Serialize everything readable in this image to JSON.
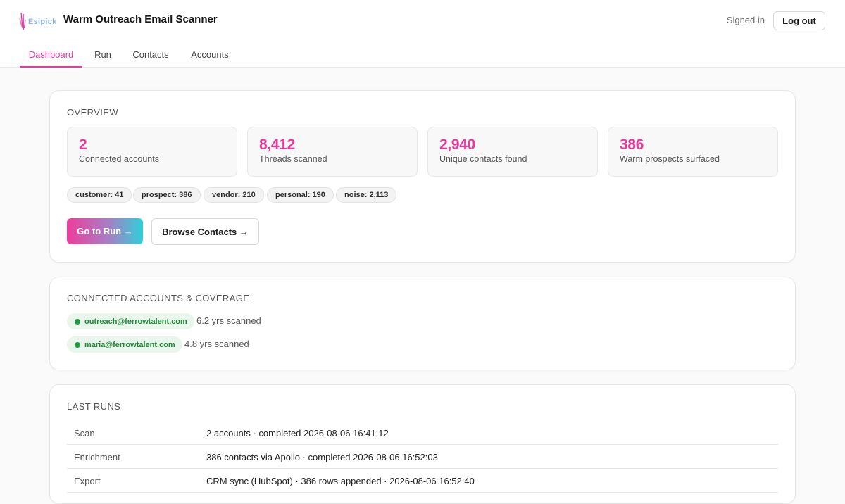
{
  "header": {
    "logo_text": "Esipick",
    "title": "Warm Outreach Email Scanner",
    "signed_in_label": "Signed in",
    "logout_label": "Log out"
  },
  "tabs": [
    {
      "label": "Dashboard",
      "active": true
    },
    {
      "label": "Run",
      "active": false
    },
    {
      "label": "Contacts",
      "active": false
    },
    {
      "label": "Accounts",
      "active": false
    }
  ],
  "overview": {
    "title": "OVERVIEW",
    "stats": [
      {
        "value": "2",
        "label": "Connected accounts"
      },
      {
        "value": "8,412",
        "label": "Threads scanned"
      },
      {
        "value": "2,940",
        "label": "Unique contacts found"
      },
      {
        "value": "386",
        "label": "Warm prospects surfaced"
      }
    ],
    "categories": [
      {
        "label": "customer: 41"
      },
      {
        "label": "prospect: 386"
      },
      {
        "label": "vendor: 210"
      },
      {
        "label": "personal: 190"
      },
      {
        "label": "noise: 2,113"
      }
    ],
    "primary_button": "Go to Run →",
    "secondary_button": "Browse Contacts →"
  },
  "accounts": {
    "title": "CONNECTED ACCOUNTS & COVERAGE",
    "items": [
      {
        "email": "outreach@ferrowtalent.com",
        "coverage": "6.2 yrs scanned"
      },
      {
        "email": "maria@ferrowtalent.com",
        "coverage": "4.8 yrs scanned"
      }
    ]
  },
  "last_runs": {
    "title": "LAST RUNS",
    "rows": [
      {
        "key": "Scan",
        "value": "2 accounts · completed 2026-08-06 16:41:12"
      },
      {
        "key": "Enrichment",
        "value": "386 contacts via Apollo · completed 2026-08-06 16:52:03"
      },
      {
        "key": "Export",
        "value": "CRM sync (HubSpot) · 386 rows appended · 2026-08-06 16:52:40"
      }
    ]
  },
  "colors": {
    "accent": "#e8399d",
    "success": "#1f8a3b",
    "gradient_start": "#ee3d9c",
    "gradient_end": "#2fd0d9"
  },
  "icons": {
    "logo": "esipick-logo-icon",
    "status_dot": "status-dot-icon"
  }
}
